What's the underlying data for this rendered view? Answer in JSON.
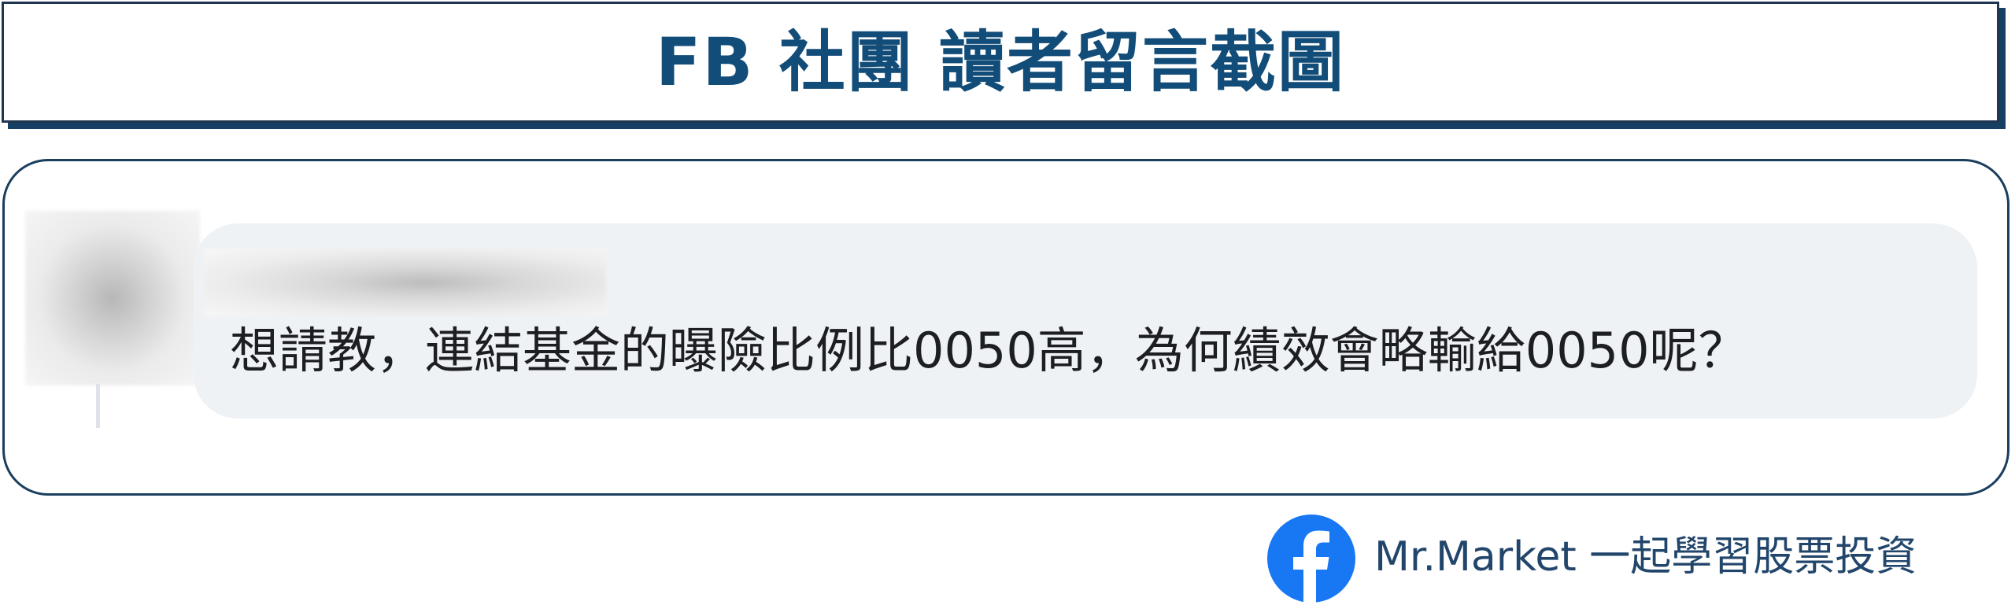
{
  "header": {
    "title": "FB 社團 讀者留言截圖"
  },
  "comment": {
    "author_name_redacted": true,
    "avatar_redacted": true,
    "text": "想請教，連結基金的曝險比例比0050高，為何績效會略輸給0050呢？"
  },
  "footer": {
    "brand_icon": "facebook-icon",
    "brand_text": "Mr.Market  一起學習股票投資"
  },
  "colors": {
    "title_blue": "#124c78",
    "banner_shadow": "#173f63",
    "card_border": "#1a3e5e",
    "bubble_bg": "#eff2f5",
    "facebook_blue": "#1877f2",
    "brand_text": "#22466b"
  }
}
